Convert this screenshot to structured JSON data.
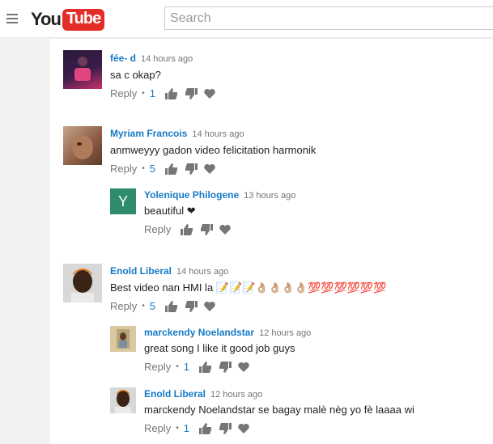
{
  "header": {
    "logo_you": "You",
    "logo_tube": "Tube",
    "search_placeholder": "Search"
  },
  "comments": [
    {
      "author": "fée- d",
      "time": "14 hours ago",
      "text": "sa c okap?",
      "reply_label": "Reply",
      "likes": "1",
      "avatar_text": ""
    },
    {
      "author": "Myriam Francois",
      "time": "14 hours ago",
      "text": "anmweyyy gadon video felicitation  harmonik",
      "reply_label": "Reply",
      "likes": "5"
    },
    {
      "author": "Yolenique Philogene",
      "time": "13 hours ago",
      "text": "beautiful ❤",
      "reply_label": "Reply",
      "avatar_letter": "Y"
    },
    {
      "author": "Enold Liberal",
      "time": "14 hours ago",
      "text": "Best video nan HMI la 📝📝📝👌🏼👌🏼👌🏼👌🏼💯💯💯💯💯💯",
      "reply_label": "Reply",
      "likes": "5"
    },
    {
      "author": "marckendy Noelandstar",
      "time": "12 hours ago",
      "text": "great song I like it good job guys",
      "reply_label": "Reply",
      "likes": "1"
    },
    {
      "author": "Enold Liberal",
      "time": "12 hours ago",
      "text": "marckendy Noelandstar se bagay malè nèg yo fè laaaa wi",
      "reply_label": "Reply",
      "likes": "1"
    }
  ],
  "colors": {
    "link": "#167ac6",
    "brand_red": "#e52d27",
    "letter_avatar": "#2e8b6e"
  }
}
